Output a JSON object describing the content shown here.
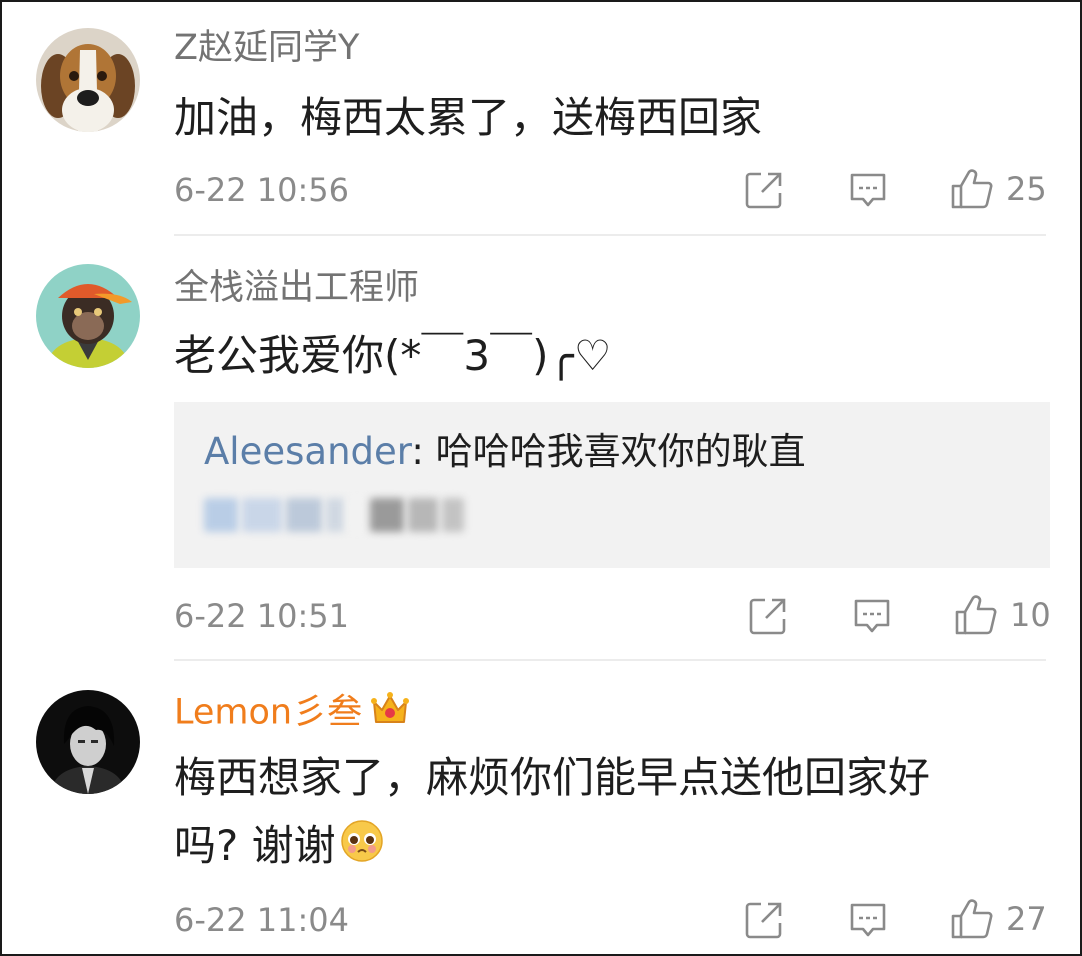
{
  "comments": [
    {
      "username": "Z赵延同学Y",
      "avatar": "beagle-dog-avatar",
      "text_lines": [
        "加油，梅西太累了，送梅西回家"
      ],
      "time": "6-22 10:56",
      "likes": "25"
    },
    {
      "username": "全栈溢出工程师",
      "avatar": "chimpanzee-cap-avatar",
      "text_lines": [
        "老公我爱你(*￣3￣)╭♡"
      ],
      "reply": {
        "user": "Aleesander",
        "separator": ": ",
        "text": "哈哈哈我喜欢你的耿直"
      },
      "time": "6-22 10:51",
      "likes": "10"
    },
    {
      "username": "Lemon彡叁",
      "username_color": "#f07d1c",
      "badge_icon": "crown-icon",
      "avatar": "dark-hair-man-avatar",
      "text_lines": [
        "梅西想家了，麻烦你们能早点送他回家好",
        "吗? 谢谢"
      ],
      "emoji_icon": "pleading-face-emoji",
      "time": "6-22 11:04",
      "likes": "27"
    }
  ],
  "icons": {
    "share": "share-icon",
    "comment": "comment-icon",
    "like": "thumbs-up-icon"
  },
  "colors": {
    "vip_name": "#f07d1c",
    "reply_user": "#5b7ea8",
    "meta_gray": "#8a8a8a"
  }
}
